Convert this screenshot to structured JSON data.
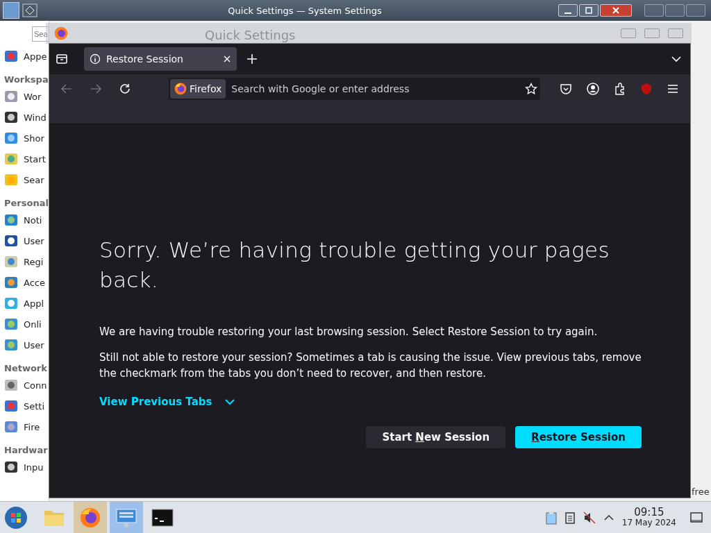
{
  "settings_window": {
    "title": "Quick Settings — System Settings",
    "search": {
      "placeholder": "Sea"
    },
    "page_title": "Quick Settings",
    "status_text": "free",
    "sidebar": [
      {
        "kind": "item",
        "label": "Appe"
      },
      {
        "kind": "heading",
        "label": "Workspa"
      },
      {
        "kind": "item",
        "label": "Wor"
      },
      {
        "kind": "item",
        "label": "Wind"
      },
      {
        "kind": "item",
        "label": "Shor"
      },
      {
        "kind": "item",
        "label": "Start"
      },
      {
        "kind": "item",
        "label": "Sear"
      },
      {
        "kind": "heading",
        "label": "Personal"
      },
      {
        "kind": "item",
        "label": "Noti"
      },
      {
        "kind": "item",
        "label": "User"
      },
      {
        "kind": "item",
        "label": "Regi"
      },
      {
        "kind": "item",
        "label": "Acce"
      },
      {
        "kind": "item",
        "label": "Appl"
      },
      {
        "kind": "item",
        "label": "Onli"
      },
      {
        "kind": "item",
        "label": "User"
      },
      {
        "kind": "heading",
        "label": "Network"
      },
      {
        "kind": "item",
        "label": "Conn"
      },
      {
        "kind": "item",
        "label": "Setti"
      },
      {
        "kind": "item",
        "label": "Fire"
      },
      {
        "kind": "heading",
        "label": "Hardwar"
      },
      {
        "kind": "item",
        "label": "Inpu"
      }
    ]
  },
  "browser": {
    "tabs": [
      {
        "label": "Restore Session",
        "selected": true
      }
    ],
    "identity_label": "Firefox",
    "address": {
      "placeholder": "Search with Google or enter address"
    },
    "heading": "Sorry. We’re having trouble getting your pages back.",
    "paragraphs": [
      "We are having trouble restoring your last browsing session. Select Restore Session to try again.",
      "Still not able to restore your session? Sometimes a tab is causing the issue. View previous tabs, remove the checkmark from the tabs you don’t need to recover, and then restore."
    ],
    "link": "View Previous Tabs",
    "buttons": [
      {
        "kind": "secondary",
        "pre": "Start ",
        "key": "N",
        "post": "ew Session"
      },
      {
        "kind": "primary",
        "key": "R",
        "post": "estore Session"
      }
    ]
  },
  "taskbar": {
    "apps": [
      {
        "kind": "folder",
        "selected": false,
        "hovered": false
      },
      {
        "kind": "firefox",
        "selected": false,
        "hovered": true
      },
      {
        "kind": "settings",
        "selected": true,
        "hovered": false
      },
      {
        "kind": "terminal",
        "selected": false,
        "hovered": false
      }
    ],
    "clock": {
      "time": "09:15",
      "date": "17 May 2024"
    }
  }
}
